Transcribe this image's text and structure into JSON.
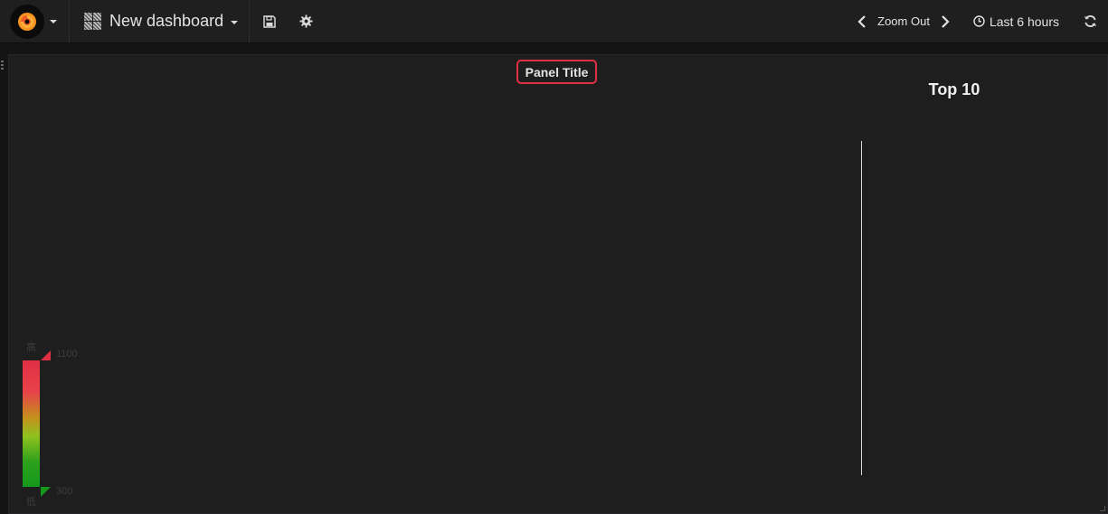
{
  "navbar": {
    "logo_icon": "grafana-logo-icon",
    "logo_caret_icon": "caret-down-icon",
    "dashboard_icon": "dashboard-grid-icon",
    "dashboard_title": "New dashboard",
    "save_icon": "save-icon",
    "settings_icon": "gear-icon",
    "zoom_back_icon": "chevron-left-icon",
    "zoom_label": "Zoom Out",
    "zoom_forward_icon": "chevron-right-icon",
    "time_icon": "clock-icon",
    "time_range": "Last 6 hours",
    "refresh_icon": "refresh-icon"
  },
  "panel": {
    "title": "Panel Title",
    "top_list_title": "Top 10",
    "legend": {
      "high_label": "高",
      "low_label": "低",
      "max_value": "1100",
      "min_value": "300",
      "high_color": "#e02f44",
      "low_color": "#14991c"
    }
  },
  "colors": {
    "accent": "#e02f44",
    "navbar_bg": "#1f1f20",
    "panel_bg": "#1f1e1f"
  }
}
